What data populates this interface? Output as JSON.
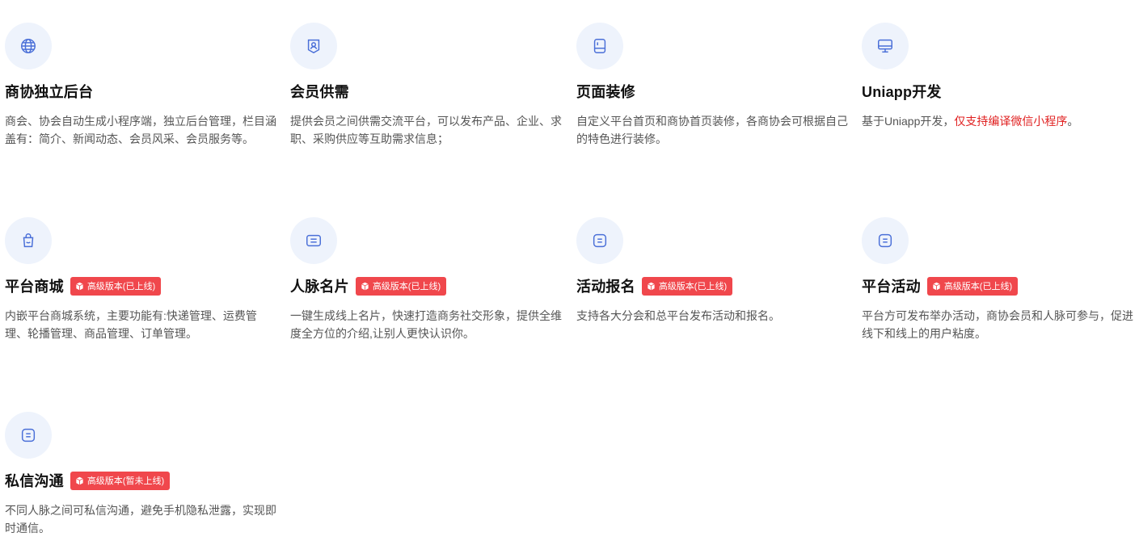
{
  "features": [
    {
      "icon": "globe-icon",
      "title": "商协独立后台",
      "desc": "商会、协会自动生成小程序端，独立后台管理，栏目涵盖有：简介、新闻动态、会员风采、会员服务等。"
    },
    {
      "icon": "member-badge-icon",
      "title": "会员供需",
      "desc": "提供会员之间供需交流平台，可以发布产品、企业、求职、采购供应等互助需求信息；"
    },
    {
      "icon": "tablet-icon",
      "title": "页面装修",
      "desc": "自定义平台首页和商协首页装修，各商协会可根据自己的特色进行装修。"
    },
    {
      "icon": "monitor-icon",
      "title": "Uniapp开发",
      "desc_prefix": "基于Uniapp开发，",
      "desc_highlight": "仅支持编译微信小程序",
      "desc_suffix": "。"
    },
    {
      "icon": "shopping-bag-icon",
      "title": "平台商城",
      "badge": "高级版本(已上线)",
      "desc": "内嵌平台商城系统，主要功能有:快递管理、运费管理、轮播管理、商品管理、订单管理。"
    },
    {
      "icon": "card-icon",
      "title": "人脉名片",
      "badge": "高级版本(已上线)",
      "desc": "一键生成线上名片，快速打造商务社交形象，提供全维度全方位的介绍,让别人更快认识你。"
    },
    {
      "icon": "list-icon",
      "title": "活动报名",
      "badge": "高级版本(已上线)",
      "desc": "支持各大分会和总平台发布活动和报名。"
    },
    {
      "icon": "list-icon",
      "title": "平台活动",
      "badge": "高级版本(已上线)",
      "desc": "平台方可发布举办活动，商协会员和人脉可参与，促进线下和线上的用户粘度。"
    },
    {
      "icon": "list-icon",
      "title": "私信沟通",
      "badge": "高级版本(暂未上线)",
      "desc": "不同人脉之间可私信沟通，避免手机隐私泄露，实现即时通信。"
    }
  ],
  "colors": {
    "accent": "#4a6fd8",
    "badge": "#f0474c",
    "highlight": "#e02020",
    "icon_bg": "#eef3fc"
  }
}
